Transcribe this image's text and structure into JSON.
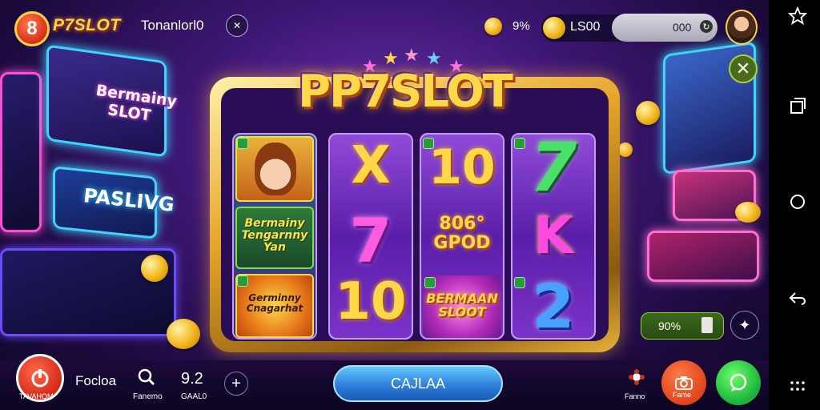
{
  "header": {
    "logo_glyph": "8",
    "brand": "P7SLOT",
    "subtitle": "Tonanlorl0",
    "close_glyph": "✕",
    "percent": "9%",
    "balance_label": "LS00",
    "balance_value": "000",
    "refresh_glyph": "↻"
  },
  "side_close_glyph": "✕",
  "cabinets": {
    "left_sign": "Bermainy SLOT",
    "left_sign_2": "PASLIVG"
  },
  "machine": {
    "title": "PP7SLOT",
    "reels": [
      {
        "green_tile": "Bermainy Tengarnny Yan",
        "orange_tile": "Germinny Cnagarhat"
      },
      {
        "symbols": [
          "X",
          "7",
          "10"
        ]
      },
      {
        "top": "10",
        "middle": "806° GPOD",
        "bottom": "BERMAAN SLOOT"
      },
      {
        "symbols": [
          "7",
          "K",
          "2"
        ]
      }
    ]
  },
  "mini_panel": {
    "percent": "90%",
    "settings_glyph": "✦"
  },
  "bottom_bar": {
    "home_label": "TAVAHOM",
    "name": "Focloa",
    "search_label": "Fanemo",
    "stat_value": "9.2",
    "stat_label": "GAAL0",
    "add_glyph": "+",
    "main_button": "CAJLAA",
    "gift_label": "Fanno",
    "camera_label": "Fame"
  },
  "colors": {
    "background": "#3b1670",
    "frame_gold": "#e6a52a",
    "title_gold": "#ffd84a",
    "neon_cyan": "#3fd5ff",
    "neon_pink": "#ff4fd8",
    "main_button": "#2a7ad8",
    "camera_button": "#e0441a",
    "chat_button": "#1ab03a"
  },
  "icons": {
    "nav_back": "back-icon",
    "nav_home": "home-circle-icon",
    "nav_recents": "recents-icon",
    "nav_settings": "settings-icon"
  }
}
